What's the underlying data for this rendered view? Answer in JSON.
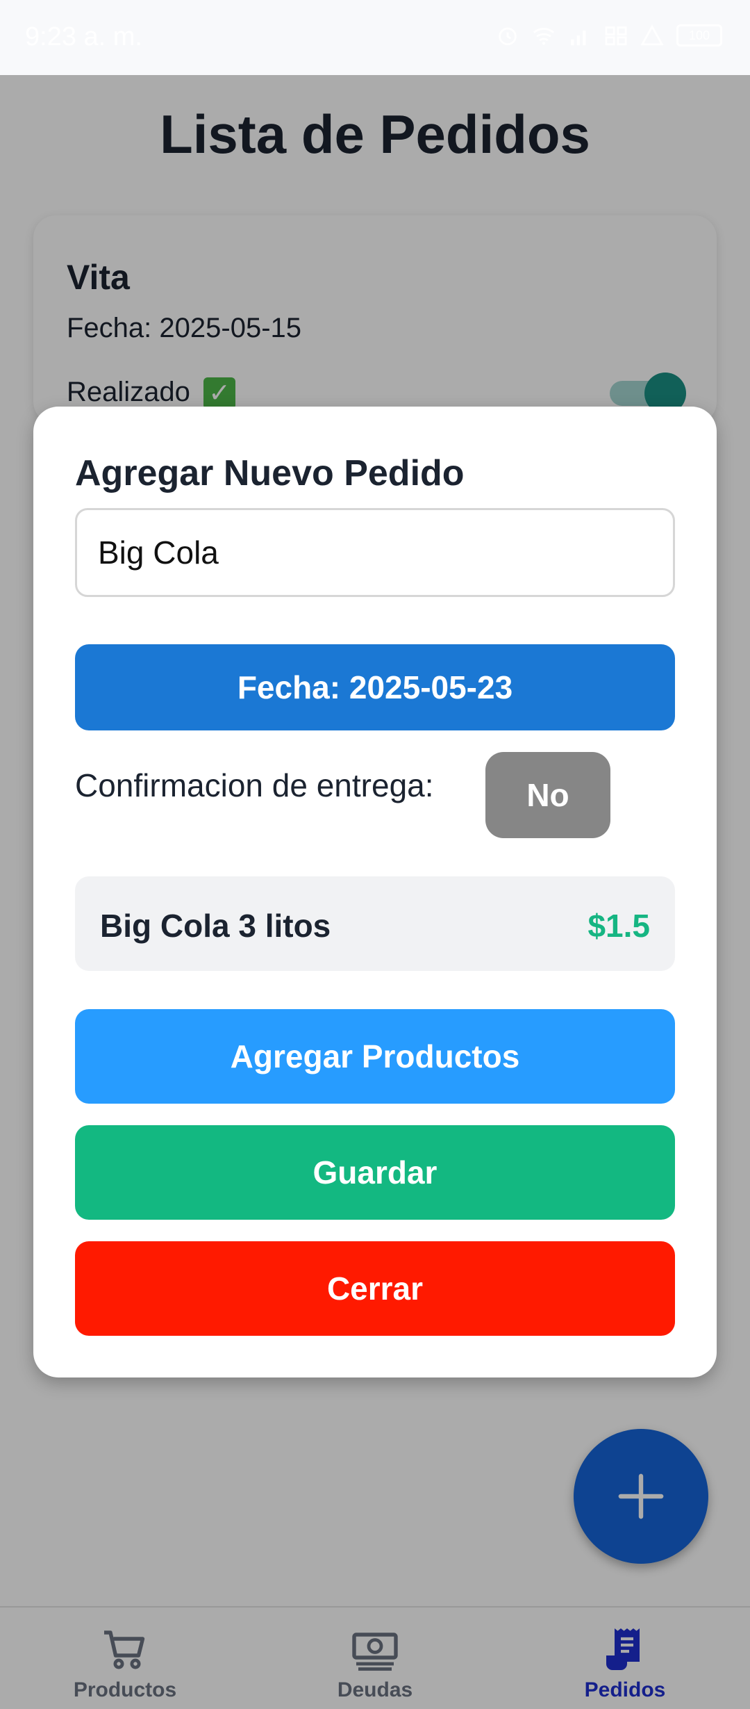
{
  "status_bar": {
    "time": "9:23 a. m.",
    "battery": "100",
    "icons": [
      "alarm-icon",
      "wifi-icon",
      "signal-icon",
      "data-icon",
      "warning-icon",
      "battery-icon"
    ]
  },
  "page": {
    "title": "Lista de Pedidos",
    "orders": [
      {
        "name": "Vita",
        "date": "Fecha: 2025-05-15",
        "status": "Realizado",
        "status_icon": "✓",
        "done": true
      }
    ]
  },
  "modal": {
    "title": "Agregar Nuevo Pedido",
    "name_value": "Big Cola",
    "date_button": "Fecha: 2025-05-23",
    "confirm_label": "Confirmacion de entrega:",
    "confirm_value": "No",
    "products": [
      {
        "name": "Big Cola 3 litos",
        "price": "$1.5"
      }
    ],
    "add_products_button": "Agregar Productos",
    "save_button": "Guardar",
    "close_button": "Cerrar"
  },
  "tabbar": {
    "tabs": [
      {
        "label": "Productos",
        "icon": "cart-icon",
        "active": false
      },
      {
        "label": "Deudas",
        "icon": "money-icon",
        "active": false
      },
      {
        "label": "Pedidos",
        "icon": "receipt-icon",
        "active": true
      }
    ]
  },
  "colors": {
    "primary_blue": "#1b78d4",
    "light_blue": "#279cff",
    "green": "#13b881",
    "red": "#ff1a00",
    "toggle_gray": "#868686",
    "fab_blue": "#1565d8",
    "active_tab": "#1e2fd0"
  }
}
